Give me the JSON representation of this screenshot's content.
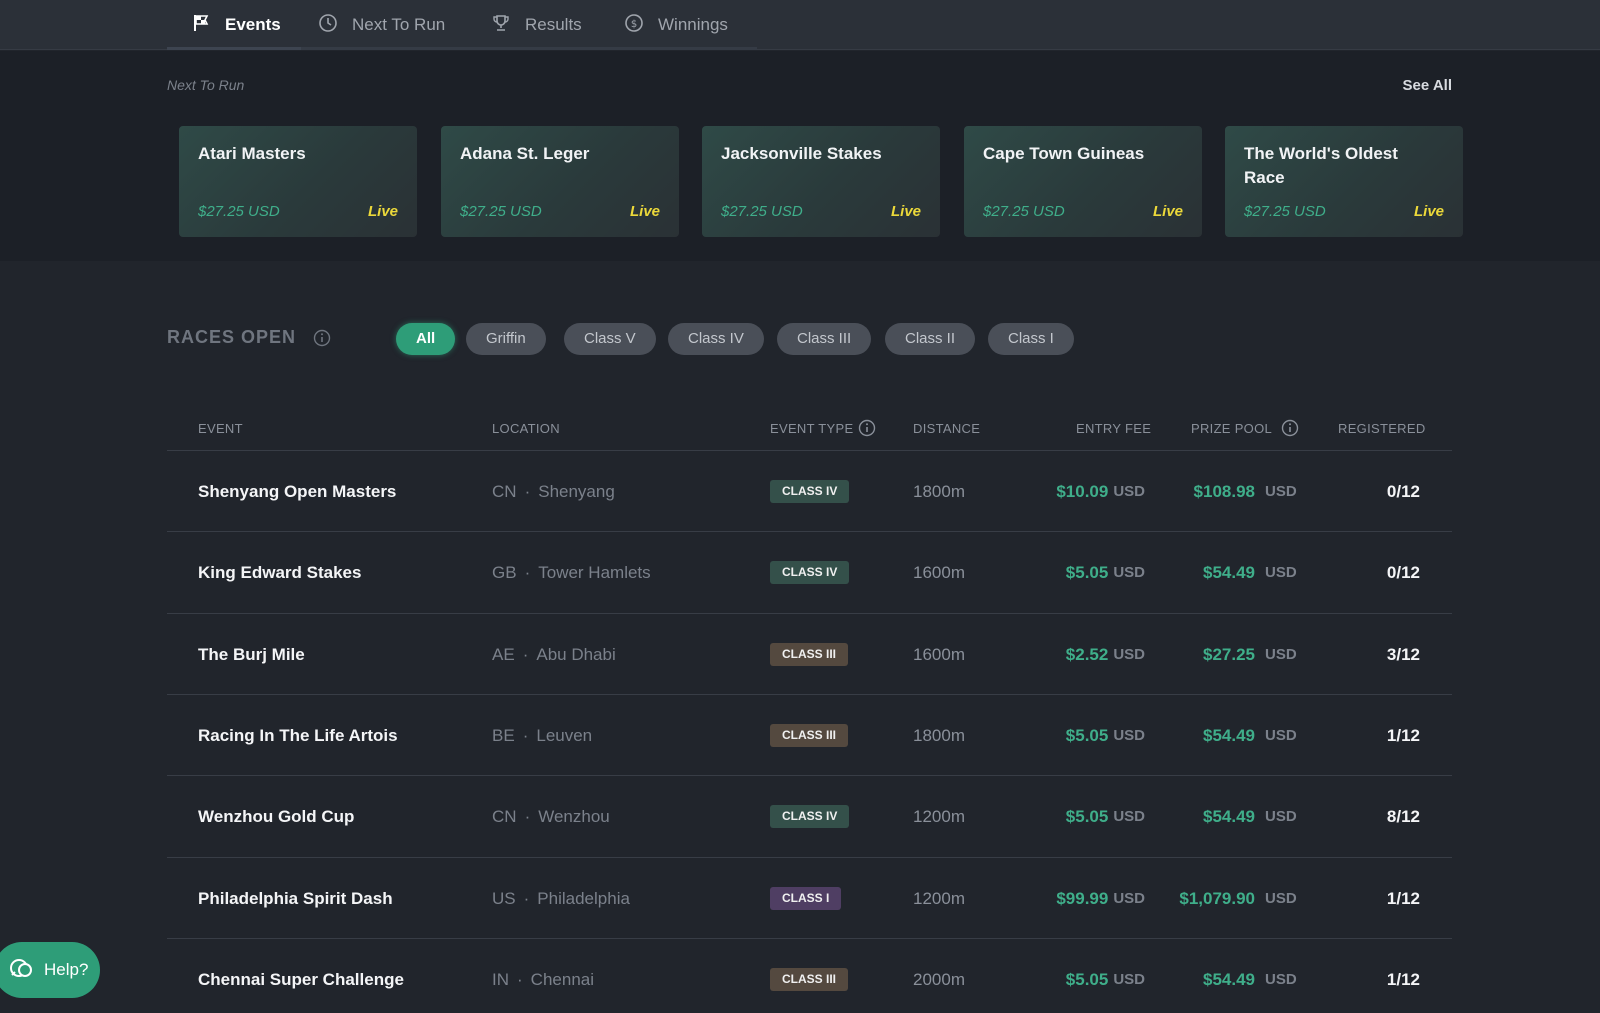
{
  "nav": {
    "tabs": [
      {
        "label": "Events",
        "icon": "flag-icon"
      },
      {
        "label": "Next To Run",
        "icon": "clock-icon"
      },
      {
        "label": "Results",
        "icon": "trophy-icon"
      },
      {
        "label": "Winnings",
        "icon": "coin-icon"
      }
    ]
  },
  "next_to_run": {
    "title": "Next To Run",
    "see_all": "See All",
    "cards": [
      {
        "name": "Atari Masters",
        "fee": "$27.25 USD",
        "status": "Live"
      },
      {
        "name": "Adana St. Leger",
        "fee": "$27.25 USD",
        "status": "Live"
      },
      {
        "name": "Jacksonville Stakes",
        "fee": "$27.25 USD",
        "status": "Live"
      },
      {
        "name": "Cape Town Guineas",
        "fee": "$27.25 USD",
        "status": "Live"
      },
      {
        "name": "The World's Oldest Race",
        "fee": "$27.25 USD",
        "status": "Live"
      }
    ]
  },
  "races": {
    "title": "RACES OPEN",
    "filters": [
      "All",
      "Griffin",
      "Class V",
      "Class IV",
      "Class III",
      "Class II",
      "Class I"
    ],
    "headers": {
      "event": "EVENT",
      "location": "LOCATION",
      "event_type": "EVENT TYPE",
      "distance": "DISTANCE",
      "entry_fee": "ENTRY FEE",
      "prize_pool": "PRIZE POOL",
      "registered": "REGISTERED"
    },
    "currency": "USD",
    "dot": "·",
    "rows": [
      {
        "name": "Shenyang Open Masters",
        "country": "CN",
        "city": "Shenyang",
        "class": "CLASS IV",
        "distance": "1800m",
        "fee": "$10.09",
        "prize": "$108.98",
        "registered": "0/12"
      },
      {
        "name": "King Edward Stakes",
        "country": "GB",
        "city": "Tower Hamlets",
        "class": "CLASS IV",
        "distance": "1600m",
        "fee": "$5.05",
        "prize": "$54.49",
        "registered": "0/12"
      },
      {
        "name": "The Burj Mile",
        "country": "AE",
        "city": "Abu Dhabi",
        "class": "CLASS III",
        "distance": "1600m",
        "fee": "$2.52",
        "prize": "$27.25",
        "registered": "3/12"
      },
      {
        "name": "Racing In The Life Artois",
        "country": "BE",
        "city": "Leuven",
        "class": "CLASS III",
        "distance": "1800m",
        "fee": "$5.05",
        "prize": "$54.49",
        "registered": "1/12"
      },
      {
        "name": "Wenzhou Gold Cup",
        "country": "CN",
        "city": "Wenzhou",
        "class": "CLASS IV",
        "distance": "1200m",
        "fee": "$5.05",
        "prize": "$54.49",
        "registered": "8/12"
      },
      {
        "name": "Philadelphia Spirit Dash",
        "country": "US",
        "city": "Philadelphia",
        "class": "CLASS I",
        "distance": "1200m",
        "fee": "$99.99",
        "prize": "$1,079.90",
        "registered": "1/12"
      },
      {
        "name": "Chennai Super Challenge",
        "country": "IN",
        "city": "Chennai",
        "class": "CLASS III",
        "distance": "2000m",
        "fee": "$5.05",
        "prize": "$54.49",
        "registered": "1/12"
      }
    ]
  },
  "class_colors": {
    "CLASS IV": "#34504a",
    "CLASS III": "#54493f",
    "CLASS I": "#4f3e63"
  },
  "help": {
    "label": "Help?"
  }
}
